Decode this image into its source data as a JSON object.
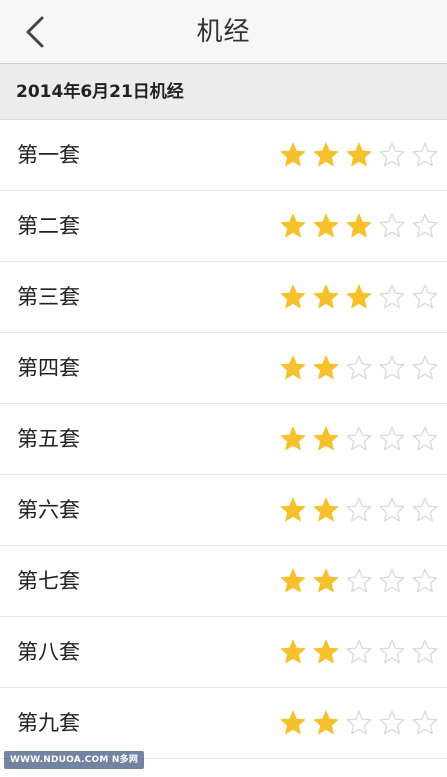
{
  "header": {
    "title": "机经",
    "back_icon": "chevron-left-icon"
  },
  "section": {
    "title": "2014年6月21日机经"
  },
  "colors": {
    "star_filled": "#f7c12e",
    "star_empty": "#d9d9d9"
  },
  "sets": [
    {
      "label": "第一套",
      "rating": 3,
      "max": 5
    },
    {
      "label": "第二套",
      "rating": 3,
      "max": 5
    },
    {
      "label": "第三套",
      "rating": 3,
      "max": 5
    },
    {
      "label": "第四套",
      "rating": 2,
      "max": 5
    },
    {
      "label": "第五套",
      "rating": 2,
      "max": 5
    },
    {
      "label": "第六套",
      "rating": 2,
      "max": 5
    },
    {
      "label": "第七套",
      "rating": 2,
      "max": 5
    },
    {
      "label": "第八套",
      "rating": 2,
      "max": 5
    },
    {
      "label": "第九套",
      "rating": 2,
      "max": 5
    }
  ],
  "watermark": "WWW.NDUOA.COM N多网"
}
